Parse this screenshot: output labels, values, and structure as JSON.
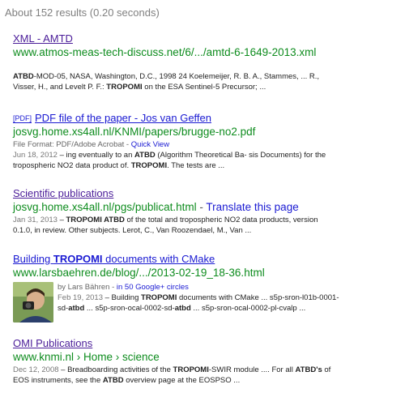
{
  "stats": "About 152 results (0.20 seconds)",
  "results": [
    {
      "title": "XML - AMTD",
      "url": "www.atmos-meas-tech-discuss.net/6/.../amtd-6-1649-2013.xml",
      "snippet_pre": "",
      "snippet_l1_a": "ATBD",
      "snippet_l1_b": "-MOD-05, NASA, Washington, D.C., 1998 24 Koelemeijer, R. B. A., Stammes, ... R.,",
      "snippet_l2_a": "Visser, H., and Levelt P. F.: ",
      "snippet_l2_b": "TROPOMI",
      "snippet_l2_c": " on the ESA Sentinel-5 Precursor; ..."
    },
    {
      "pdf_tag": "[PDF]",
      "title": "PDF file of the paper - Jos van Geffen",
      "url": "josvg.home.xs4all.nl/KNMI/papers/brugge-no2.pdf",
      "meta_format": "File Format: PDF/Adobe Acrobat - ",
      "meta_quick": "Quick View",
      "date": "Jun 18, 2012",
      "snippet_l1_a": " – ing eventually to an ",
      "snippet_l1_b": "ATBD",
      "snippet_l1_c": " (Algorithm Theoretical Ba- sis Documents) for the",
      "snippet_l2_a": "tropospheric NO2 data product of. ",
      "snippet_l2_b": "TROPOMI",
      "snippet_l2_c": ". The tests are ..."
    },
    {
      "title": "Scientific publications",
      "url": "josvg.home.xs4all.nl/pgs/publicat.html",
      "url_sep": " - ",
      "translate": "Translate this page",
      "date": "Jan 31, 2013",
      "snippet_l1_a": " – ",
      "snippet_l1_b": "TROPOMI ATBD",
      "snippet_l1_c": " of the total and tropospheric NO2 data products, version",
      "snippet_l2": "0.1.0, in review. Other subjects. Lerot, C., Van Roozendael, M., Van ..."
    },
    {
      "title_a": "Building ",
      "title_b": "TROPOMI",
      "title_c": " documents with CMake",
      "url": "www.larsbaehren.de/blog/.../2013-02-19_18-36.html",
      "author": "by Lars Bähren - ",
      "circles": "in 50 Google+ circles",
      "date": "Feb 19, 2013",
      "snippet_l1_a": " – Building ",
      "snippet_l1_b": "TROPOMI",
      "snippet_l1_c": " documents with CMake ... s5p-sron-l01b-0001-",
      "snippet_l2_a": "sd-",
      "snippet_l2_b": "atbd",
      "snippet_l2_c": " ... s5p-sron-ocal-0002-sd-",
      "snippet_l2_d": "atbd",
      "snippet_l2_e": " ... s5p-sron-ocal-0002-pl-cvalp ..."
    },
    {
      "title": "OMI Publications",
      "url_a": "www.knmi.nl",
      "url_b": " › Home › science",
      "date": "Dec 12, 2008",
      "snippet_l1_a": " – Breadboarding activities of the ",
      "snippet_l1_b": "TROPOMI",
      "snippet_l1_c": "-SWIR module .... For all ",
      "snippet_l1_d": "ATBD's",
      "snippet_l1_e": " of",
      "snippet_l2_a": "EOS instruments, see the ",
      "snippet_l2_b": "ATBD",
      "snippet_l2_c": " overview page at the EOSPSO ..."
    }
  ]
}
